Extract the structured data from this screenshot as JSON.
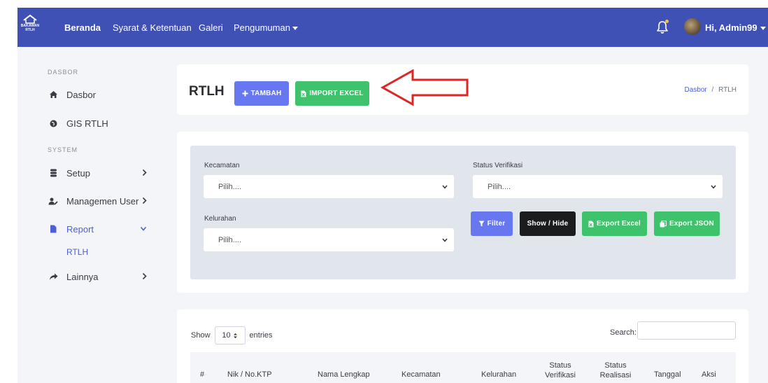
{
  "navbar": {
    "logo_line1": "BAKAWAN",
    "logo_line2": "RTLH",
    "links": [
      {
        "label": "Beranda"
      },
      {
        "label": "Syarat & Ketentuan"
      },
      {
        "label": "Galeri"
      },
      {
        "label": "Pengumuman"
      }
    ],
    "user_greeting": "Hi, Admin99"
  },
  "sidebar": {
    "section_dasbor": "DASBOR",
    "section_system": "SYSTEM",
    "items": [
      {
        "label": "Dasbor",
        "icon": "home-icon"
      },
      {
        "label": "GIS RTLH",
        "icon": "globe-icon"
      },
      {
        "label": "Setup",
        "icon": "database-icon"
      },
      {
        "label": "Managemen User",
        "icon": "user-edit-icon"
      },
      {
        "label": "Report",
        "icon": "file-icon"
      },
      {
        "label": "Lainnya",
        "icon": "share-icon"
      }
    ],
    "report_sub": "RTLH"
  },
  "header": {
    "title": "RTLH",
    "add_button": "TAMBAH",
    "import_button": "IMPORT EXCEL",
    "breadcrumb_link": "Dasbor",
    "breadcrumb_sep": "/",
    "breadcrumb_current": "RTLH"
  },
  "filters": {
    "kecamatan_label": "Kecamatan",
    "kecamatan_value": "Pilih....",
    "status_label": "Status Verifikasi",
    "status_value": "Pilih....",
    "kelurahan_label": "Kelurahan",
    "kelurahan_value": "Pilih....",
    "filter_button": "Filter",
    "showhide_button": "Show / Hide",
    "export_excel_button": "Export Excel",
    "export_json_button": "Export JSON"
  },
  "table": {
    "show_label": "Show",
    "entries_value": "10",
    "entries_label": "entries",
    "search_label": "Search:",
    "columns": [
      "#",
      "Nik / No.KTP",
      "Nama Lengkap",
      "Kecamatan",
      "Kelurahan",
      "Status Verifikasi",
      "Status Realisasi",
      "Tanggal",
      "Aksi"
    ]
  },
  "colors": {
    "navbar": "#3f51b5",
    "primary": "#6777ef",
    "success": "#3ec26b",
    "dark": "#1b1c1e",
    "annotation_arrow": "#e02424"
  }
}
